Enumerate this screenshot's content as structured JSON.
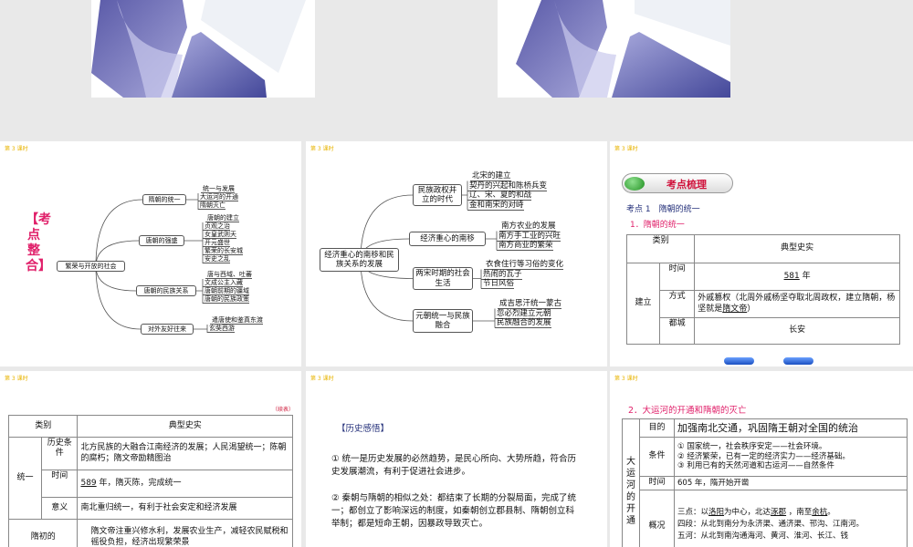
{
  "slide_tag": "第 3 课时",
  "colors": {
    "tag": "#e8b400",
    "pink": "#e0206a",
    "navy": "#24307a",
    "green": "#2a9a2a"
  },
  "map1": {
    "side_title": "【考点整合】",
    "center": "繁荣与开放的社会",
    "branches": [
      {
        "label": "隋朝的统一",
        "items": [
          "统一与发展",
          "大运河的开通",
          "隋朝灭亡"
        ]
      },
      {
        "label": "唐朝的强盛",
        "items": [
          "唐朝的建立",
          "贞观之治",
          "女皇武则天",
          "开元盛世",
          "繁荣的长安城",
          "安史之乱"
        ]
      },
      {
        "label": "唐朝的民族关系",
        "items": [
          "唐与西域、吐蕃",
          "文成公主入藏",
          "唐朝前期的疆域",
          "唐朝的民族政策"
        ]
      },
      {
        "label": "对外友好往来",
        "items": [
          "遣唐使和鉴真东渡",
          "玄奘西游"
        ]
      }
    ]
  },
  "map2": {
    "center": "经济重心的南移和民族关系的发展",
    "branches": [
      {
        "label": "民族政权并立的时代",
        "items": [
          "北宋的建立",
          "契丹的兴起和陈桥兵变",
          "辽、宋、夏的和战",
          "金和南宋的对峙"
        ]
      },
      {
        "label": "经济重心的南移",
        "items": [
          "南方农业的发展",
          "南方手工业的兴旺",
          "南方商业的繁荣"
        ]
      },
      {
        "label": "两宋时期的社会生活",
        "items": [
          "衣食住行等习俗的变化",
          "热闹的瓦子",
          "节日风俗"
        ]
      },
      {
        "label": "元朝统一与民族融合",
        "items": [
          "成吉思汗统一蒙古",
          "忽必烈建立元朝",
          "民族融合的发展"
        ]
      }
    ]
  },
  "slide3": {
    "pill": "考点梳理",
    "point": "考点 1　隋朝的统一",
    "sub": "1．隋朝的统一",
    "h_cat": "类别",
    "h_fact": "典型史实",
    "group": "建立",
    "rows": [
      {
        "k": "时间",
        "v_u": "581",
        "v": " 年"
      },
      {
        "k": "方式",
        "v": "外戚篡权（北周外戚杨坚夺取北周政权，建立隋朝，杨坚就是",
        "v_u": "隋文帝",
        "v2": "）"
      },
      {
        "k": "都城",
        "v": "长安"
      }
    ]
  },
  "slide4": {
    "cont": "（续表）",
    "h_cat": "类别",
    "h_fact": "典型史实",
    "group": "统一",
    "cond_k": "历史条件",
    "cond_v": "北方民族的大融合江南经济的发展；人民渴望统一；陈朝的腐朽；隋文帝励精图治",
    "time_k": "时间",
    "time_u": "589",
    "time_v": " 年，隋灭陈，完成统一",
    "sig_k": "意义",
    "sig_v": "南北重归统一，有利于社会安定和经济发展",
    "last_k": "隋初的",
    "last_v": "隋文帝注重兴修水利，发展农业生产，减轻农民赋税和徭役负担，经济出现繁荣景"
  },
  "slide5": {
    "title": "【历史感悟】",
    "p1": "① 统一是历史发展的必然趋势，是民心所向、大势所趋，符合历史发展潮流，有利于促进社会进步。",
    "p2": "② 秦朝与隋朝的相似之处：都结束了长期的分裂局面，完成了统一；都创立了影响深远的制度，如秦朝创立郡县制、隋朝创立科举制；都是短命王朝，因暴政导致灭亡。"
  },
  "slide6": {
    "title": "2．大运河的开通和隋朝的灭亡",
    "group": "大运河的开通",
    "aim_k": "目的",
    "aim_v": "加强南北交通，巩固隋王朝对全国的统治",
    "cond_k": "条件",
    "cond_v": [
      "① 国家统一，社会秩序安定——社会环境。",
      "② 经济繁荣，已有一定的经济实力——经济基础。",
      "③ 利用已有的天然河道和古运河——自然条件"
    ],
    "time_k": "时间",
    "time_v": "605 年，隋开始开凿",
    "ov_k": "概况",
    "ov_a": "三点：以",
    "ov_b": "洛阳",
    "ov_c": "为中心，北达",
    "ov_d": "涿郡",
    "ov_e": " ，南至",
    "ov_f": "余杭",
    "ov_g": "。",
    "ov_2": "四段：从北到南分为永济渠、通济渠、邗沟、江南河。",
    "ov_3": "五河：从北到南沟通海河、黄河、淮河、长江、钱"
  }
}
